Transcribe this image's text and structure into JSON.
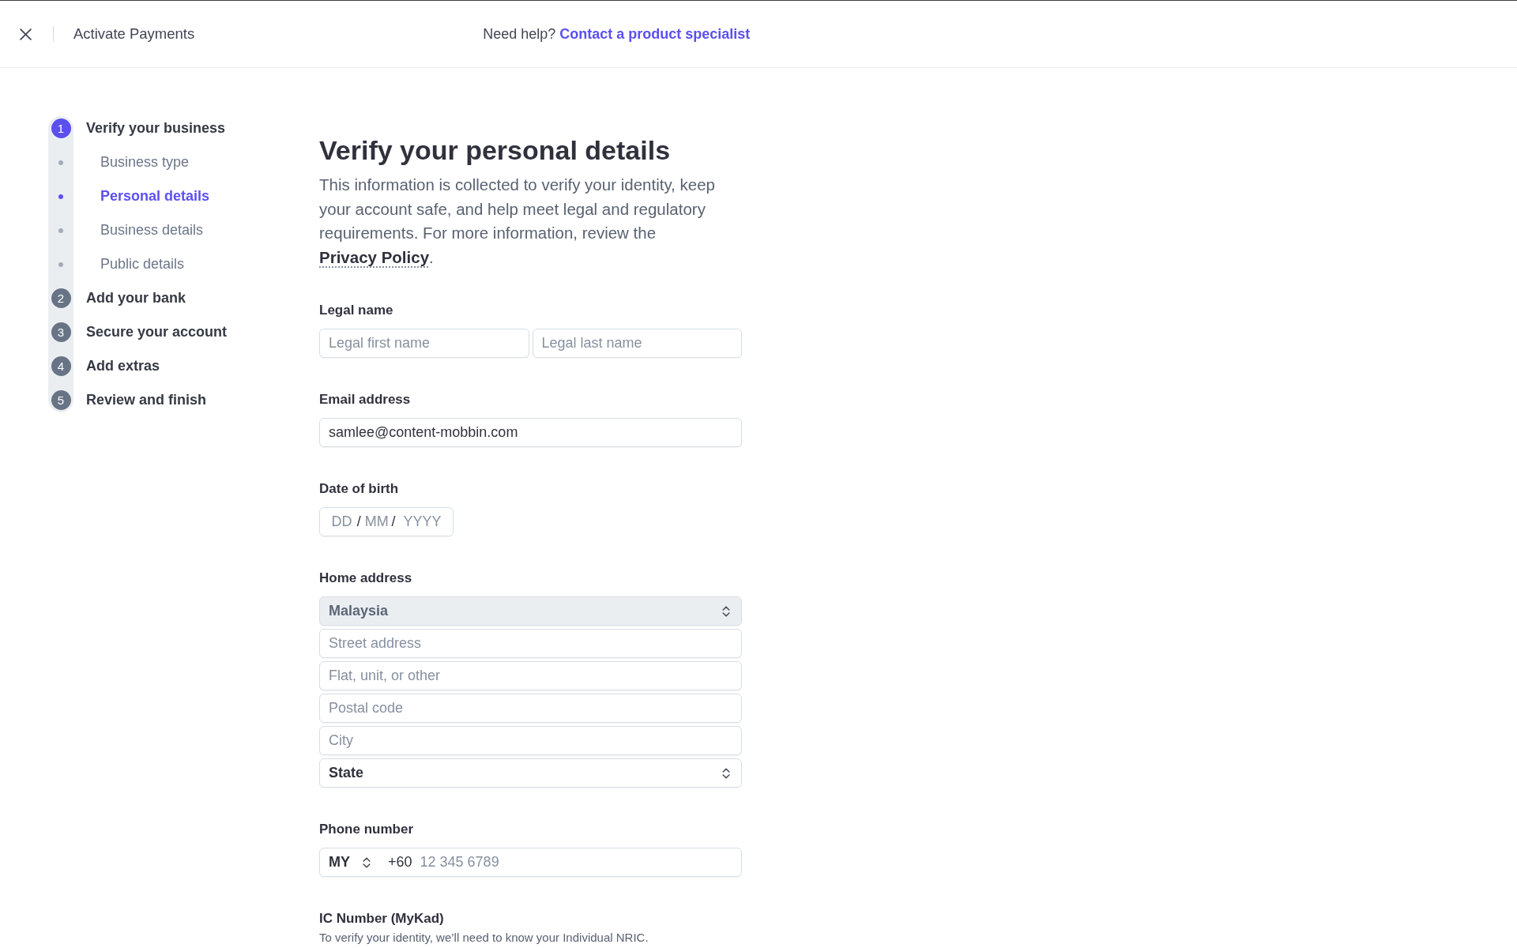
{
  "header": {
    "title": "Activate Payments",
    "help_text": "Need help?",
    "help_link": "Contact a product specialist"
  },
  "steps": [
    {
      "number": "1",
      "label": "Verify your business",
      "selected": true,
      "children": [
        {
          "label": "Business type",
          "selected": false
        },
        {
          "label": "Personal details",
          "selected": true
        },
        {
          "label": "Business details",
          "selected": false
        },
        {
          "label": "Public details",
          "selected": false
        }
      ]
    },
    {
      "number": "2",
      "label": "Add your bank",
      "selected": false
    },
    {
      "number": "3",
      "label": "Secure your account",
      "selected": false
    },
    {
      "number": "4",
      "label": "Add extras",
      "selected": false
    },
    {
      "number": "5",
      "label": "Review and finish",
      "selected": false
    }
  ],
  "form": {
    "title": "Verify your personal details",
    "intro": {
      "text": "This information is collected to verify your identity, keep your account safe, and help meet legal and regulatory requirements. For more information, review the",
      "link": "Privacy Policy",
      "after": "."
    },
    "sections": [
      {
        "kind": "name_pair",
        "label": "Legal name",
        "fields": [
          {
            "placeholder": "Legal first name"
          },
          {
            "placeholder": "Legal last name"
          }
        ]
      },
      {
        "kind": "text",
        "label": "Email address",
        "value": "samlee@content-mobbin.com"
      },
      {
        "kind": "date",
        "label": "Date of birth",
        "parts": [
          {
            "kind": "segment",
            "placeholder": "DD"
          },
          {
            "kind": "separator",
            "text": "/"
          },
          {
            "kind": "segment",
            "placeholder": "MM"
          },
          {
            "kind": "separator",
            "text": "/"
          },
          {
            "kind": "segment",
            "placeholder": "YYYY"
          }
        ]
      },
      {
        "kind": "address",
        "label": "Home address",
        "fields": [
          {
            "kind": "select",
            "value": "Malaysia",
            "disabled": true
          },
          {
            "kind": "input",
            "placeholder": "Street address"
          },
          {
            "kind": "input",
            "placeholder": "Flat, unit, or other"
          },
          {
            "kind": "input",
            "placeholder": "Postal code"
          },
          {
            "kind": "input",
            "placeholder": "City"
          },
          {
            "kind": "select",
            "value": "State",
            "disabled": false
          }
        ]
      },
      {
        "kind": "phone",
        "label": "Phone number",
        "country": "MY",
        "prefix": "+60",
        "placeholder": "12 345 6789"
      },
      {
        "kind": "note",
        "label": "IC Number (MyKad)",
        "hint": "To verify your identity, we’ll need to know your Individual NRIC."
      }
    ]
  }
}
